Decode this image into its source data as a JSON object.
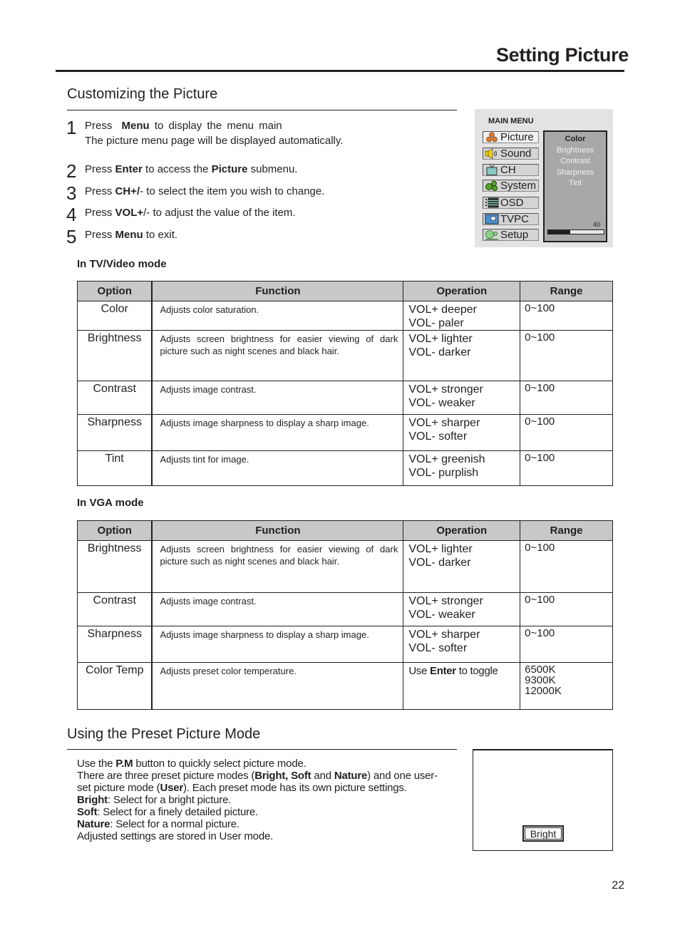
{
  "header": {
    "title": "Setting Picture"
  },
  "customizing": {
    "title": "Customizing the Picture",
    "steps": [
      {
        "num": "1",
        "pre": "Press ",
        "b1": "Menu",
        "mid": " to display the menu main",
        "line2": "The picture menu page will be displayed automatically."
      },
      {
        "num": "2",
        "pre": "Press ",
        "b1": "Enter",
        "mid": " to access the ",
        "b2": "Picture",
        "post": " submenu."
      },
      {
        "num": "3",
        "pre": "Press ",
        "b1": "CH+/",
        "mid": "- to select the item you wish to change."
      },
      {
        "num": "4",
        "pre": "Press ",
        "b1": "VOL+",
        "mid": "/- to adjust the value of the item."
      },
      {
        "num": "5",
        "pre": "Press ",
        "b1": "Menu",
        "mid": " to exit."
      }
    ]
  },
  "osd": {
    "title": "MAIN MENU",
    "items": [
      {
        "label": "Picture",
        "icon": "picture-icon",
        "active": true
      },
      {
        "label": "Sound",
        "icon": "speaker-icon"
      },
      {
        "label": "CH",
        "icon": "tv-icon"
      },
      {
        "label": "System",
        "icon": "gears-icon"
      },
      {
        "label": "OSD",
        "icon": "list-icon"
      },
      {
        "label": "TVPC",
        "icon": "monitor-icon"
      },
      {
        "label": "Setup",
        "icon": "setup-icon"
      }
    ],
    "submenu": {
      "selected": "Color",
      "options": [
        "Brightness",
        "Contrast",
        "Sharpness",
        "Tint"
      ]
    },
    "value": "40",
    "level_percent": 40
  },
  "tv_table": {
    "label": "In TV/Video mode",
    "headers": [
      "Option",
      "Function",
      "Operation",
      "Range"
    ],
    "rows": [
      {
        "option": "Color",
        "function": "Adjusts color saturation.",
        "op1": "VOL+  deeper",
        "op2": "VOL-  paler",
        "range": "0~100"
      },
      {
        "option": "Brightness",
        "function": "Adjusts screen brightness for easier viewing of dark picture such as night scenes and black hair.",
        "op1": "VOL+  lighter",
        "op2": "VOL-  darker",
        "range": "0~100"
      },
      {
        "option": "Contrast",
        "function": "Adjusts image contrast.",
        "op1": "VOL+  stronger",
        "op2": "VOL-  weaker",
        "range": "0~100"
      },
      {
        "option": "Sharpness",
        "function": "Adjusts image sharpness to display a sharp image.",
        "op1": "VOL+  sharper",
        "op2": "VOL-  softer",
        "range": "0~100"
      },
      {
        "option": "Tint",
        "function": "Adjusts tint for image.",
        "op1": "VOL+  greenish",
        "op2": "VOL-  purplish",
        "range": "0~100"
      }
    ]
  },
  "vga_table": {
    "label": "In VGA mode",
    "headers": [
      "Option",
      "Function",
      "Operation",
      "Range"
    ],
    "rows": [
      {
        "option": "Brightness",
        "function": "Adjusts screen brightness for easier viewing of dark picture such as night scenes and black hair.",
        "op1": "VOL+  lighter",
        "op2": "VOL-  darker",
        "range": "0~100"
      },
      {
        "option": "Contrast",
        "function": "Adjusts image contrast.",
        "op1": "VOL+  stronger",
        "op2": "VOL-  weaker",
        "range": "0~100"
      },
      {
        "option": "Sharpness",
        "function": "Adjusts image sharpness to display a sharp image.",
        "op1": "VOL+  sharper",
        "op2": "VOL-  softer",
        "range": "0~100"
      },
      {
        "option": "Color Temp",
        "function": "Adjusts preset color temperature.",
        "op_pre": "Use ",
        "op_bold": "Enter",
        "op_post": " to toggle",
        "range1": "6500K",
        "range2": "9300K",
        "range3": "12000K"
      }
    ]
  },
  "preset": {
    "title": "Using the Preset Picture Mode",
    "l1_pre": "Use the ",
    "l1_b": "P.M",
    "l1_post": " button to quickly select picture mode.",
    "l2_pre": "There are three preset picture modes (",
    "l2_b1": "Bright, Soft",
    "l2_mid": " and ",
    "l2_b2": "Nature",
    "l2_post": ") and one user-",
    "l3_pre": "set picture mode (",
    "l3_b": "User",
    "l3_post": "). Each preset mode has its own picture settings.",
    "l4_b": "Bright",
    "l4_post": ": Select for a bright picture.",
    "l5_b": "Soft",
    "l5_post": ": Select for a finely detailed picture.",
    "l6_b": "Nature",
    "l6_post": ": Select for a normal picture.",
    "l7": "Adjusted settings are stored in User mode.",
    "osd_label": "Bright"
  },
  "footer": {
    "page_number": "22"
  }
}
